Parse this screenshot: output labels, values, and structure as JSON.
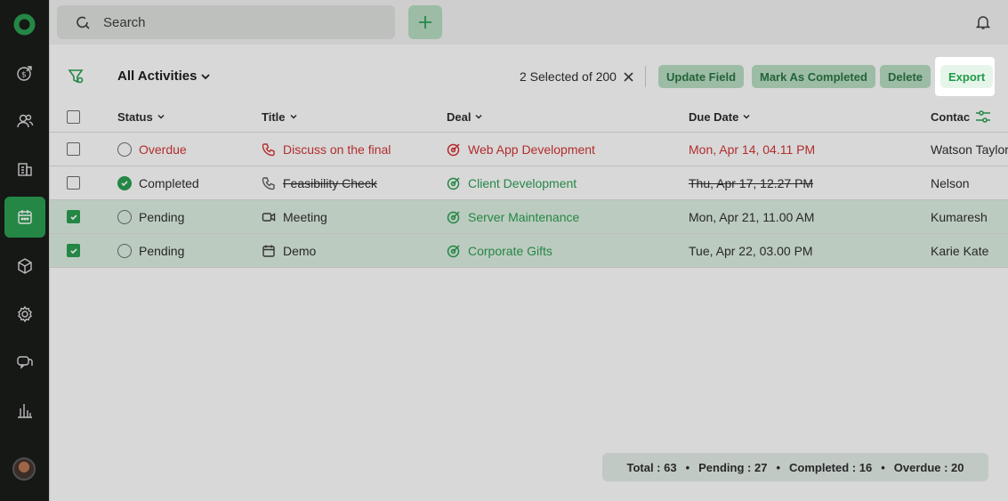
{
  "colors": {
    "accent": "#1f9a48",
    "danger": "#d12a2a",
    "sidebar": "#0d0f0d"
  },
  "sidebar": {
    "icons": [
      "logo-icon",
      "deals-icon",
      "contacts-icon",
      "companies-icon",
      "calendar-icon",
      "products-icon",
      "settings-icon",
      "chat-icon",
      "reports-icon"
    ],
    "active": "calendar-icon"
  },
  "search": {
    "placeholder": "Search"
  },
  "toolbar": {
    "view_label": "All Activities",
    "selection": "2 Selected of 200",
    "update_field": "Update Field",
    "mark_completed": "Mark As Completed",
    "delete": "Delete",
    "export": "Export"
  },
  "table": {
    "headers": {
      "status": "Status",
      "title": "Title",
      "deal": "Deal",
      "due": "Due Date",
      "contact": "Contac"
    },
    "rows": [
      {
        "checked": false,
        "status": "Overdue",
        "title": "Discuss on the final",
        "title_icon": "phone-icon",
        "deal": "Web App Development",
        "due": "Mon, Apr 14, 04.11 PM",
        "contact": "Watson Taylor"
      },
      {
        "checked": false,
        "status": "Completed",
        "title": "Feasibility Check",
        "title_icon": "phone-icon",
        "deal": "Client Development",
        "due": "Thu, Apr 17, 12.27 PM",
        "contact": "Nelson"
      },
      {
        "checked": true,
        "status": "Pending",
        "title": "Meeting",
        "title_icon": "video-icon",
        "deal": "Server Maintenance",
        "due": "Mon, Apr 21, 11.00 AM",
        "contact": "Kumaresh"
      },
      {
        "checked": true,
        "status": "Pending",
        "title": "Demo",
        "title_icon": "calendar-icon",
        "deal": "Corporate Gifts",
        "due": "Tue, Apr 22, 03.00 PM",
        "contact": "Karie Kate"
      }
    ]
  },
  "summary": {
    "total": "Total : 63",
    "pending": "Pending : 27",
    "completed": "Completed : 16",
    "overdue": "Overdue : 20"
  }
}
